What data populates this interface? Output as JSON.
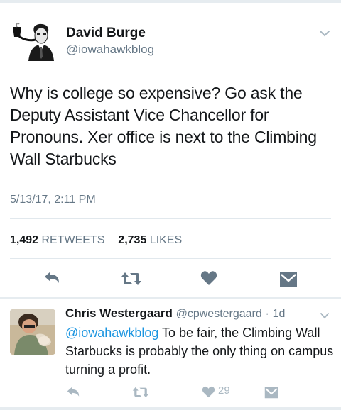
{
  "main_tweet": {
    "author_name": "David Burge",
    "author_handle": "@iowahawkblog",
    "text": "Why is college so expensive? Go ask the Deputy Assistant Vice Chancellor for Pronouns. Xer office is next to the Climbing Wall Starbucks",
    "timestamp": "5/13/17, 2:11 PM",
    "retweet_count": "1,492",
    "retweet_label": "RETWEETS",
    "like_count": "2,735",
    "like_label": "LIKES",
    "actions": [
      "reply-icon",
      "retweet-icon",
      "heart-icon",
      "direct-message-icon"
    ]
  },
  "reply_tweet": {
    "author_name": "Chris Westergaard",
    "author_handle": "@cpwestergaard",
    "separator": "·",
    "time": "1d",
    "mention": "@iowahawkblog",
    "text": " To be fair, the Climbing Wall Starbucks is probably the only thing on campus turning a profit.",
    "like_count": "29",
    "actions": [
      "reply-icon",
      "retweet-icon",
      "heart-icon",
      "direct-message-icon"
    ]
  },
  "colors": {
    "text_primary": "#14171a",
    "text_secondary": "#657786",
    "icon_main": "#657786",
    "icon_reply": "#aab8c2",
    "link": "#1b95e0",
    "divider": "#e1e8ed",
    "section_bg": "#e6ecf0"
  }
}
